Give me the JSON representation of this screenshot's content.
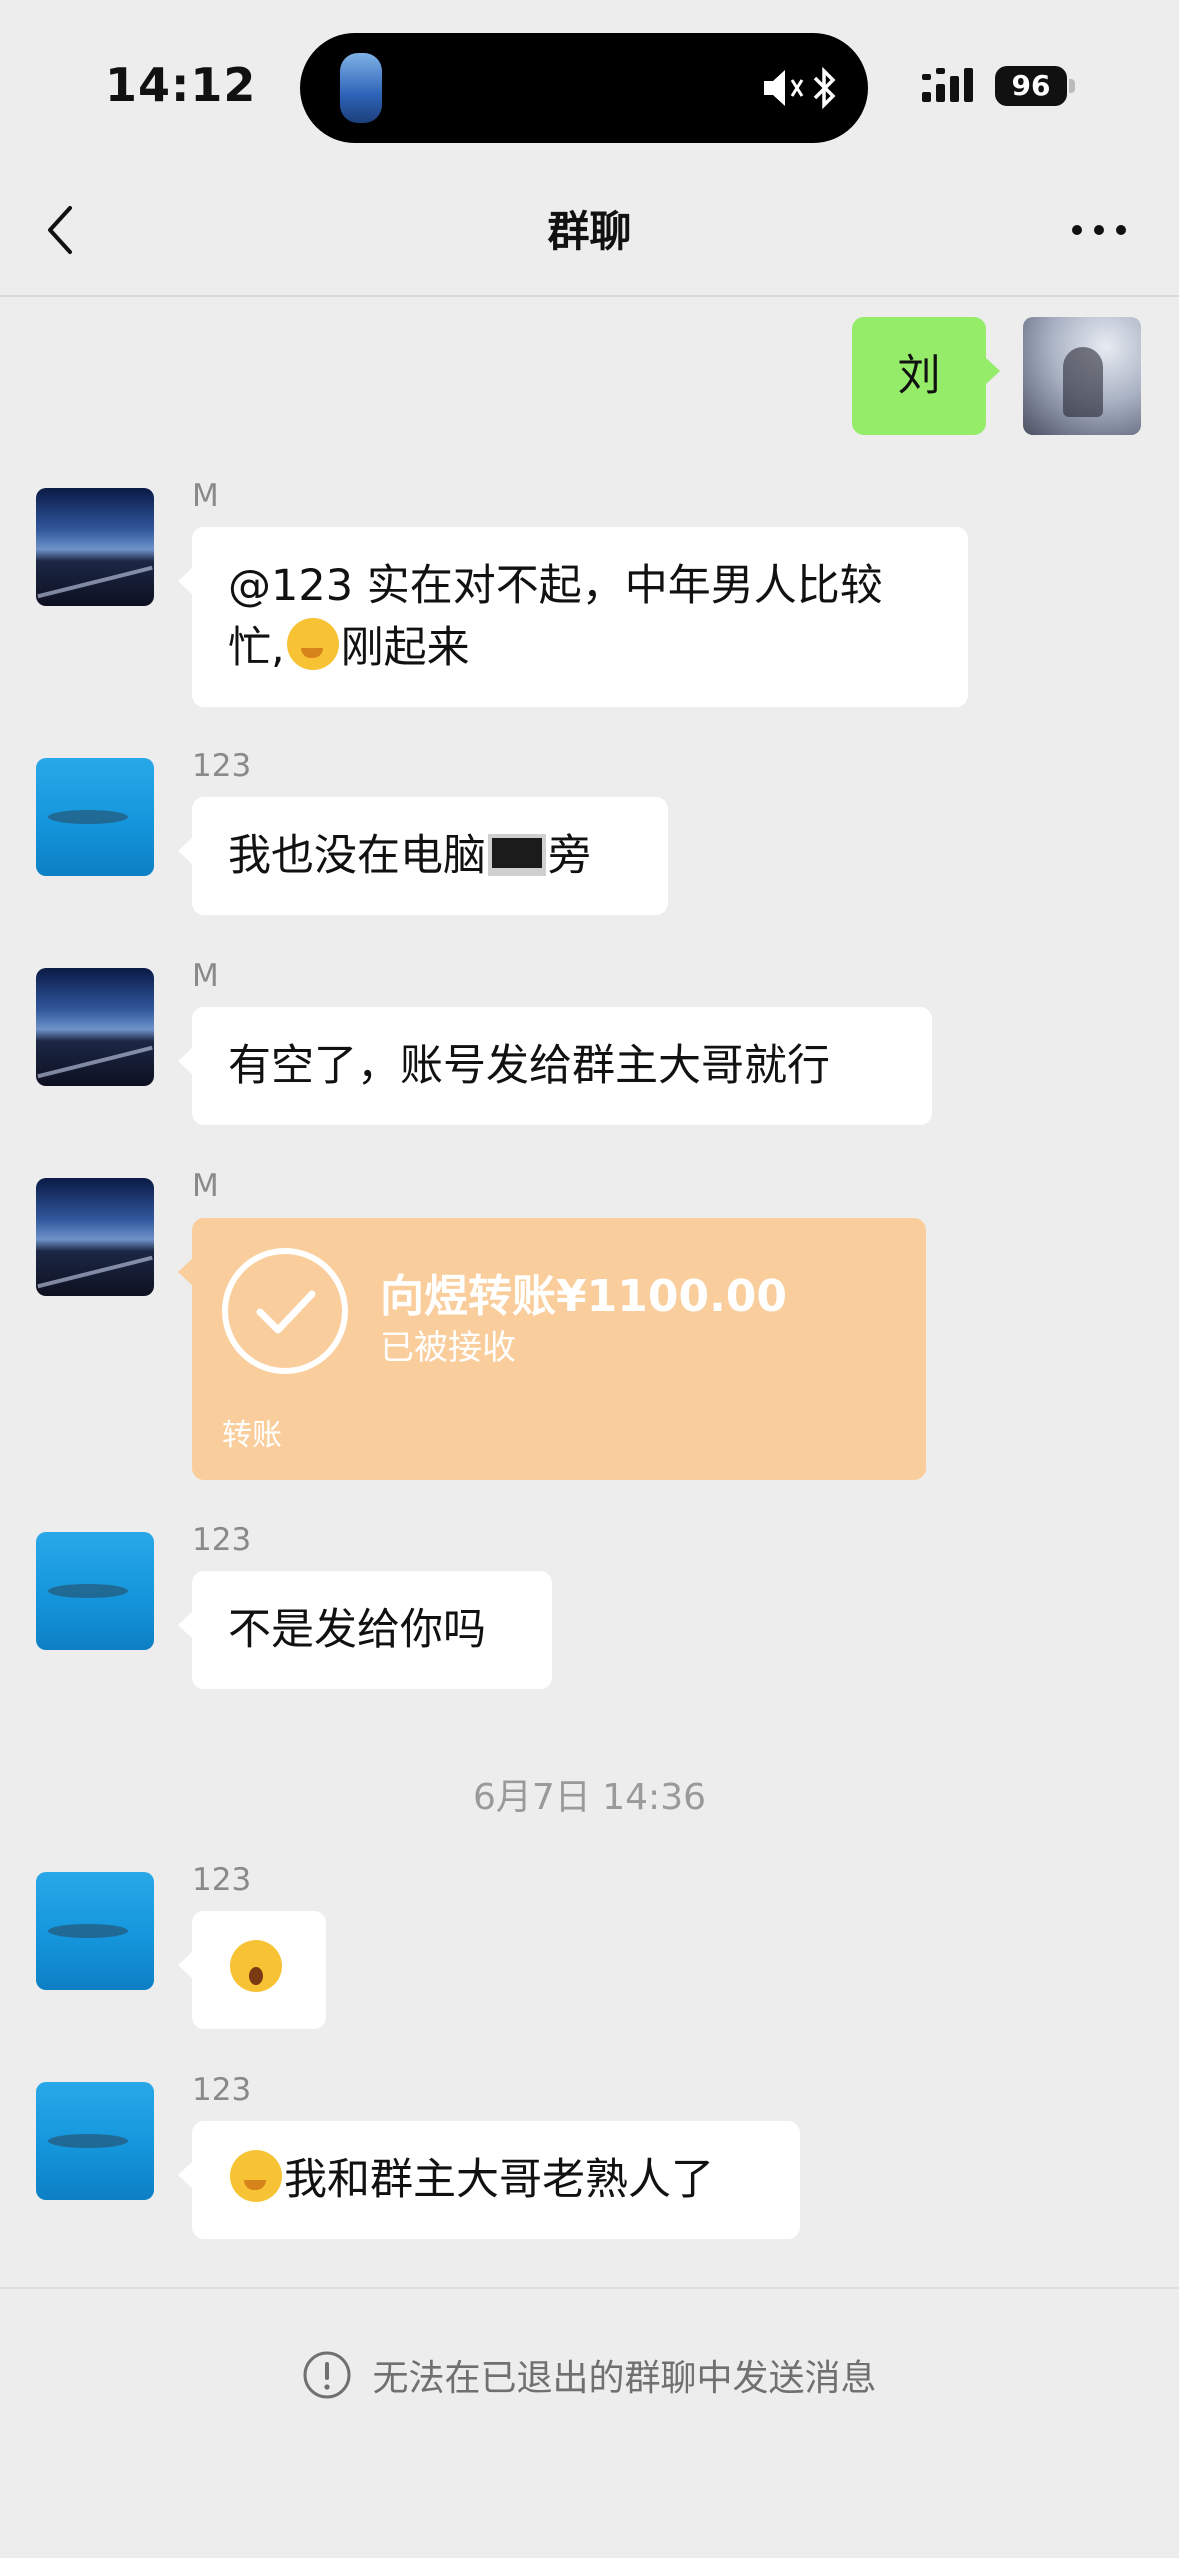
{
  "status_bar": {
    "time": "14:12",
    "battery": "96"
  },
  "nav": {
    "title": "群聊"
  },
  "self_message": {
    "text": "刘"
  },
  "messages": [
    {
      "sender": "M",
      "line1": "@123 实在对不起，中年男人比较",
      "line2_a": "忙,",
      "line2_b": "刚起来"
    },
    {
      "sender": "123",
      "text_a": "我也没在电脑",
      "text_b": "旁"
    },
    {
      "sender": "M",
      "text": "有空了，账号发给群主大哥就行"
    },
    {
      "sender": "M"
    },
    {
      "sender": "123",
      "text": "不是发给你吗"
    },
    {
      "sender": "123"
    },
    {
      "sender": "123",
      "text": "我和群主大哥老熟人了"
    }
  ],
  "transfer": {
    "amount_text": "向煜转账¥1100.00",
    "status": "已被接收",
    "label": "转账"
  },
  "timestamp": "6月7日 14:36",
  "footer": {
    "notice": "无法在已退出的群聊中发送消息"
  },
  "colors": {
    "background": "#ededed",
    "self_bubble": "#95ec69",
    "transfer_card": "#f9ce9c"
  }
}
